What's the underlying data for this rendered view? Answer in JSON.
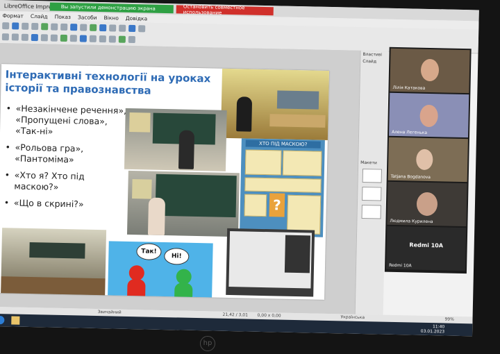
{
  "window": {
    "title": "LibreOffice Impress",
    "share_banner": "Вы запустили демонстрацию экрана",
    "stop_button": "Остановить совместное использование"
  },
  "menu": [
    "Формат",
    "Слайд",
    "Показ",
    "Засоби",
    "Вікно",
    "Довідка"
  ],
  "slide": {
    "title": "Інтерактивні технології на уроках історії та правознавства",
    "bullets": [
      "«Незакінчене речення», «Пропущені слова», «Так-ні»",
      "«Рольова гра», «Пантоміма»",
      "«Хто я? Хто під маскою?»",
      "«Що в скрині?»"
    ],
    "mask_heading": "ХТО ПІД МАСКОЮ?",
    "bubble_left": "Так!",
    "bubble_right": "Ні!"
  },
  "sidebar": {
    "properties": "Властиві",
    "slide_section": "Слайд",
    "layouts": "Макети"
  },
  "participants": [
    {
      "name": "Лілія Катакова"
    },
    {
      "name": "Алена Легенька"
    },
    {
      "name": "Tatjana Bogdanova"
    },
    {
      "name": "Людмила Курилена"
    },
    {
      "name": "Redmi 10A",
      "label": "Redmi 10A"
    }
  ],
  "status": {
    "mode": "Звичайний",
    "position": "21,42 / 3,01",
    "size": "0,00 x 0,00",
    "language": "Українська",
    "zoom": "99%"
  },
  "clock": {
    "time": "11:40",
    "date": "03.01.2023"
  },
  "brand": "hp",
  "colors": {
    "title_blue": "#2e6bb5",
    "share_green": "#2ea043",
    "stop_red": "#d0302b"
  }
}
